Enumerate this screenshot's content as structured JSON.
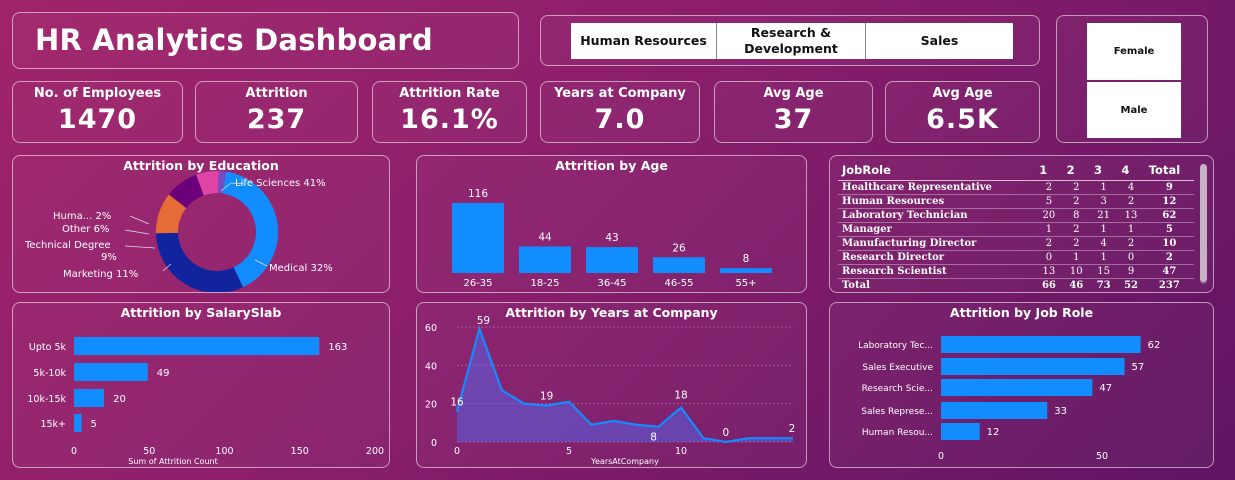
{
  "dashboard": {
    "title": "HR Analytics Dashboard"
  },
  "departments": [
    "Human Resources",
    "Research & Development",
    "Sales"
  ],
  "genders": [
    "Female",
    "Male"
  ],
  "kpis": [
    {
      "label": "No. of Employees",
      "value": "1470"
    },
    {
      "label": "Attrition",
      "value": "237"
    },
    {
      "label": "Attrition Rate",
      "value": "16.1%"
    },
    {
      "label": "Years at Company",
      "value": "7.0"
    },
    {
      "label": "Avg Age",
      "value": "37"
    },
    {
      "label": "Avg Age",
      "value": "6.5K"
    }
  ],
  "job_role_table": {
    "headers": [
      "JobRole",
      "1",
      "2",
      "3",
      "4",
      "Total"
    ],
    "rows": [
      [
        "Healthcare Representative",
        "2",
        "2",
        "1",
        "4",
        "9"
      ],
      [
        "Human Resources",
        "5",
        "2",
        "3",
        "2",
        "12"
      ],
      [
        "Laboratory Technician",
        "20",
        "8",
        "21",
        "13",
        "62"
      ],
      [
        "Manager",
        "1",
        "2",
        "1",
        "1",
        "5"
      ],
      [
        "Manufacturing Director",
        "2",
        "2",
        "4",
        "2",
        "10"
      ],
      [
        "Research Director",
        "0",
        "1",
        "1",
        "0",
        "2"
      ],
      [
        "Research Scientist",
        "13",
        "10",
        "15",
        "9",
        "47"
      ]
    ],
    "total": [
      "Total",
      "66",
      "46",
      "73",
      "52",
      "237"
    ]
  },
  "colors": {
    "bar": "#118dff",
    "medical": "#12239e",
    "marketing": "#e66c37",
    "technical": "#6b007b",
    "other": "#e044a7",
    "human": "#744ec2"
  },
  "chart_data": [
    {
      "type": "pie",
      "title": "Attrition by Education",
      "categories": [
        "Life Sciences",
        "Medical",
        "Marketing",
        "Technical Degree",
        "Other",
        "Human Resources"
      ],
      "values": [
        41,
        32,
        11,
        9,
        6,
        2
      ],
      "labels": [
        "Life Sciences 41%",
        "Medical 32%",
        "Marketing 11%",
        "Technical Degree",
        "9%",
        "Other 6%",
        "Huma... 2%"
      ]
    },
    {
      "type": "bar",
      "title": "Attrition by Age",
      "categories": [
        "26-35",
        "18-25",
        "36-45",
        "46-55",
        "55+"
      ],
      "values": [
        116,
        44,
        43,
        26,
        8
      ]
    },
    {
      "type": "bar",
      "title": "Attrition by SalarySlab",
      "categories": [
        "Upto 5k",
        "5k-10k",
        "10k-15k",
        "15k+"
      ],
      "values": [
        163,
        49,
        20,
        5
      ],
      "xlabel": "Sum of Attrition Count",
      "xlim": [
        0,
        200
      ],
      "xticks": [
        "0",
        "50",
        "100",
        "150",
        "200"
      ]
    },
    {
      "type": "area",
      "title": "Attrition by Years at Company",
      "x": [
        0,
        1,
        2,
        3,
        4,
        5,
        6,
        7,
        8,
        9,
        10,
        11,
        12,
        13,
        14,
        15
      ],
      "values": [
        16,
        59,
        27,
        20,
        19,
        21,
        9,
        11,
        9,
        8,
        18,
        2,
        0,
        2,
        2,
        2
      ],
      "point_labels": [
        "16",
        "59",
        "19",
        "8",
        "18",
        "0",
        "2"
      ],
      "xlabel": "YearsAtCompany",
      "ylim": [
        0,
        60
      ],
      "yticks": [
        "0",
        "20",
        "40",
        "60"
      ],
      "xticks": [
        "0",
        "5",
        "10"
      ]
    },
    {
      "type": "bar",
      "title": "Attrition by Job Role",
      "categories": [
        "Laboratory Tec...",
        "Sales Executive",
        "Research Scie...",
        "Sales Represe...",
        "Human Resou..."
      ],
      "values": [
        62,
        57,
        47,
        33,
        12
      ],
      "xticks": [
        "0",
        "50"
      ]
    }
  ]
}
